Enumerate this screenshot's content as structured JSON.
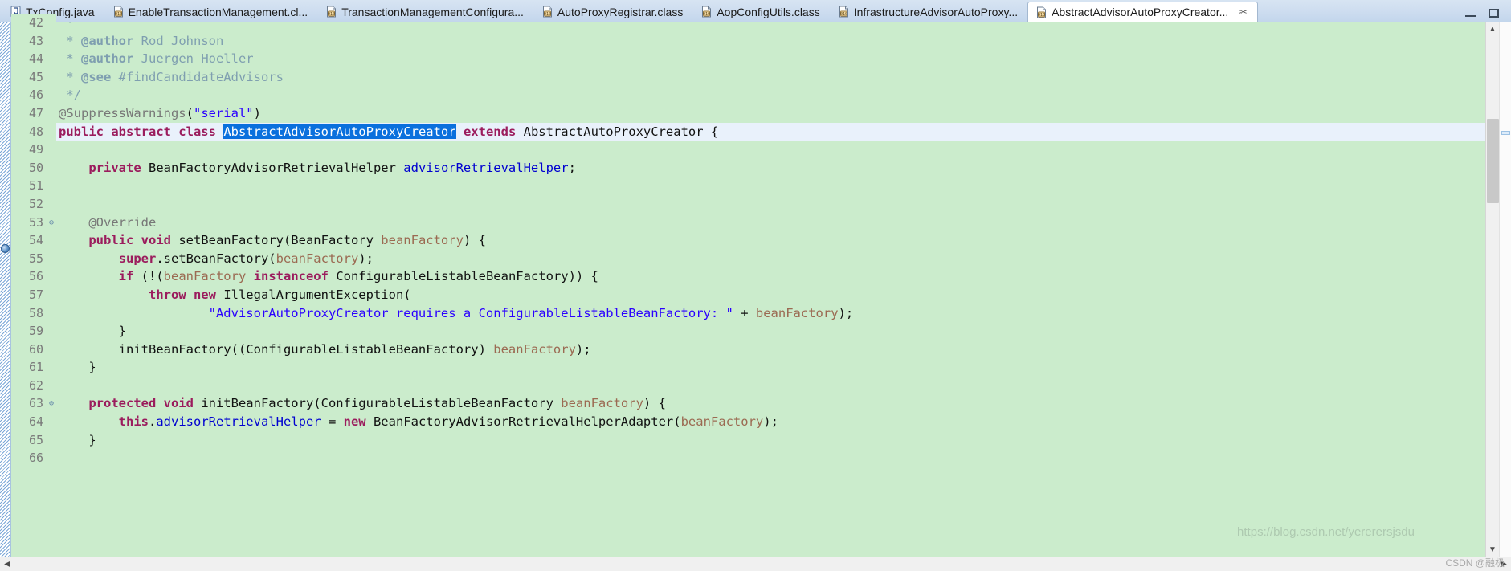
{
  "window": {
    "minimize_label": "Minimize",
    "maximize_label": "Maximize"
  },
  "tabs": [
    {
      "label": "TxConfig.java",
      "icon": "java-source-icon",
      "active": false,
      "closable": false
    },
    {
      "label": "EnableTransactionManagement.cl...",
      "icon": "java-class-icon",
      "active": false,
      "closable": false
    },
    {
      "label": "TransactionManagementConfigura...",
      "icon": "java-class-icon",
      "active": false,
      "closable": false
    },
    {
      "label": "AutoProxyRegistrar.class",
      "icon": "java-class-icon",
      "active": false,
      "closable": false
    },
    {
      "label": "AopConfigUtils.class",
      "icon": "java-class-icon",
      "active": false,
      "closable": false
    },
    {
      "label": "InfrastructureAdvisorAutoProxy...",
      "icon": "java-class-icon",
      "active": false,
      "closable": false
    },
    {
      "label": "AbstractAdvisorAutoProxyCreator...",
      "icon": "java-class-icon",
      "active": true,
      "closable": true,
      "close_label": "✂"
    }
  ],
  "editor": {
    "first_visible_line": 42,
    "current_line": 48,
    "selection_text": "AbstractAdvisorAutoProxyCreator",
    "lines": [
      {
        "num": 42,
        "fold": "",
        "clipped": true,
        "tokens": [
          {
            "t": " *",
            "c": "cmt"
          }
        ]
      },
      {
        "num": 43,
        "fold": "",
        "tokens": [
          {
            "t": " * ",
            "c": "cmt"
          },
          {
            "t": "@author",
            "c": "cmt-tag"
          },
          {
            "t": " Rod Johnson",
            "c": "cmt"
          }
        ]
      },
      {
        "num": 44,
        "fold": "",
        "tokens": [
          {
            "t": " * ",
            "c": "cmt"
          },
          {
            "t": "@author",
            "c": "cmt-tag"
          },
          {
            "t": " Juergen Hoeller",
            "c": "cmt"
          }
        ]
      },
      {
        "num": 45,
        "fold": "",
        "tokens": [
          {
            "t": " * ",
            "c": "cmt"
          },
          {
            "t": "@see",
            "c": "cmt-tag"
          },
          {
            "t": " #findCandidateAdvisors",
            "c": "cmt"
          }
        ]
      },
      {
        "num": 46,
        "fold": "",
        "tokens": [
          {
            "t": " */",
            "c": "cmt"
          }
        ]
      },
      {
        "num": 47,
        "fold": "",
        "tokens": [
          {
            "t": "@SuppressWarnings",
            "c": "anno"
          },
          {
            "t": "(",
            "c": "plain"
          },
          {
            "t": "\"serial\"",
            "c": "str"
          },
          {
            "t": ")",
            "c": "plain"
          }
        ]
      },
      {
        "num": 48,
        "fold": "",
        "current": true,
        "tokens": [
          {
            "t": "public abstract class ",
            "c": "kw"
          },
          {
            "t": "AbstractAdvisorAutoProxyCreator",
            "c": "sel"
          },
          {
            "t": " ",
            "c": "plain"
          },
          {
            "t": "extends",
            "c": "kw"
          },
          {
            "t": " AbstractAutoProxyCreator {",
            "c": "plain"
          }
        ]
      },
      {
        "num": 49,
        "fold": "",
        "tokens": []
      },
      {
        "num": 50,
        "fold": "",
        "tokens": [
          {
            "t": "    ",
            "c": "plain"
          },
          {
            "t": "private",
            "c": "kw"
          },
          {
            "t": " BeanFactoryAdvisorRetrievalHelper ",
            "c": "plain"
          },
          {
            "t": "advisorRetrievalHelper",
            "c": "field"
          },
          {
            "t": ";",
            "c": "plain"
          }
        ]
      },
      {
        "num": 51,
        "fold": "",
        "tokens": []
      },
      {
        "num": 52,
        "fold": "",
        "tokens": []
      },
      {
        "num": 53,
        "fold": "⊖",
        "tokens": [
          {
            "t": "    ",
            "c": "plain"
          },
          {
            "t": "@Override",
            "c": "anno"
          }
        ]
      },
      {
        "num": 54,
        "fold": "",
        "marker": true,
        "tokens": [
          {
            "t": "    ",
            "c": "plain"
          },
          {
            "t": "public void ",
            "c": "kw"
          },
          {
            "t": "setBeanFactory(BeanFactory ",
            "c": "plain"
          },
          {
            "t": "beanFactory",
            "c": "param"
          },
          {
            "t": ") {",
            "c": "plain"
          }
        ]
      },
      {
        "num": 55,
        "fold": "",
        "tokens": [
          {
            "t": "        ",
            "c": "plain"
          },
          {
            "t": "super",
            "c": "kw"
          },
          {
            "t": ".setBeanFactory(",
            "c": "plain"
          },
          {
            "t": "beanFactory",
            "c": "param"
          },
          {
            "t": ");",
            "c": "plain"
          }
        ]
      },
      {
        "num": 56,
        "fold": "",
        "tokens": [
          {
            "t": "        ",
            "c": "plain"
          },
          {
            "t": "if",
            "c": "kw"
          },
          {
            "t": " (!(",
            "c": "plain"
          },
          {
            "t": "beanFactory",
            "c": "param"
          },
          {
            "t": " ",
            "c": "plain"
          },
          {
            "t": "instanceof",
            "c": "kw"
          },
          {
            "t": " ConfigurableListableBeanFactory)) {",
            "c": "plain"
          }
        ]
      },
      {
        "num": 57,
        "fold": "",
        "tokens": [
          {
            "t": "            ",
            "c": "plain"
          },
          {
            "t": "throw new",
            "c": "kw"
          },
          {
            "t": " IllegalArgumentException(",
            "c": "plain"
          }
        ]
      },
      {
        "num": 58,
        "fold": "",
        "tokens": [
          {
            "t": "                    ",
            "c": "plain"
          },
          {
            "t": "\"AdvisorAutoProxyCreator requires a ConfigurableListableBeanFactory: \"",
            "c": "str"
          },
          {
            "t": " + ",
            "c": "plain"
          },
          {
            "t": "beanFactory",
            "c": "param"
          },
          {
            "t": ");",
            "c": "plain"
          }
        ]
      },
      {
        "num": 59,
        "fold": "",
        "tokens": [
          {
            "t": "        }",
            "c": "plain"
          }
        ]
      },
      {
        "num": 60,
        "fold": "",
        "tokens": [
          {
            "t": "        initBeanFactory((ConfigurableListableBeanFactory) ",
            "c": "plain"
          },
          {
            "t": "beanFactory",
            "c": "param"
          },
          {
            "t": ");",
            "c": "plain"
          }
        ]
      },
      {
        "num": 61,
        "fold": "",
        "tokens": [
          {
            "t": "    }",
            "c": "plain"
          }
        ]
      },
      {
        "num": 62,
        "fold": "",
        "tokens": []
      },
      {
        "num": 63,
        "fold": "⊖",
        "tokens": [
          {
            "t": "    ",
            "c": "plain"
          },
          {
            "t": "protected void ",
            "c": "kw"
          },
          {
            "t": "initBeanFactory(ConfigurableListableBeanFactory ",
            "c": "plain"
          },
          {
            "t": "beanFactory",
            "c": "param"
          },
          {
            "t": ") {",
            "c": "plain"
          }
        ]
      },
      {
        "num": 64,
        "fold": "",
        "tokens": [
          {
            "t": "        ",
            "c": "plain"
          },
          {
            "t": "this",
            "c": "kw"
          },
          {
            "t": ".",
            "c": "plain"
          },
          {
            "t": "advisorRetrievalHelper",
            "c": "field"
          },
          {
            "t": " = ",
            "c": "plain"
          },
          {
            "t": "new",
            "c": "kw"
          },
          {
            "t": " BeanFactoryAdvisorRetrievalHelperAdapter(",
            "c": "plain"
          },
          {
            "t": "beanFactory",
            "c": "param"
          },
          {
            "t": ");",
            "c": "plain"
          }
        ]
      },
      {
        "num": 65,
        "fold": "",
        "tokens": [
          {
            "t": "    }",
            "c": "plain"
          }
        ]
      },
      {
        "num": 66,
        "fold": "",
        "clipped": true,
        "tokens": []
      }
    ]
  },
  "scrollbars": {
    "vertical_up_icon": "chevron-up-icon",
    "vertical_down_icon": "chevron-down-icon",
    "horizontal_left_icon": "chevron-left-icon",
    "horizontal_right_icon": "chevron-right-icon"
  },
  "watermark": {
    "url": "https://blog.csdn.net/yererersjsdu",
    "credit": "CSDN @融极"
  },
  "colors": {
    "editor_background": "#cbeccc",
    "current_line": "#e9f1fb",
    "selection": "#0a70dd",
    "keyword": "#9b1c5d",
    "string": "#2a00ff",
    "comment": "#7f9fb0",
    "field": "#0000d0",
    "parameter": "#9b6a52",
    "annotation": "#777777",
    "tab_bar": "#cfdef0"
  }
}
